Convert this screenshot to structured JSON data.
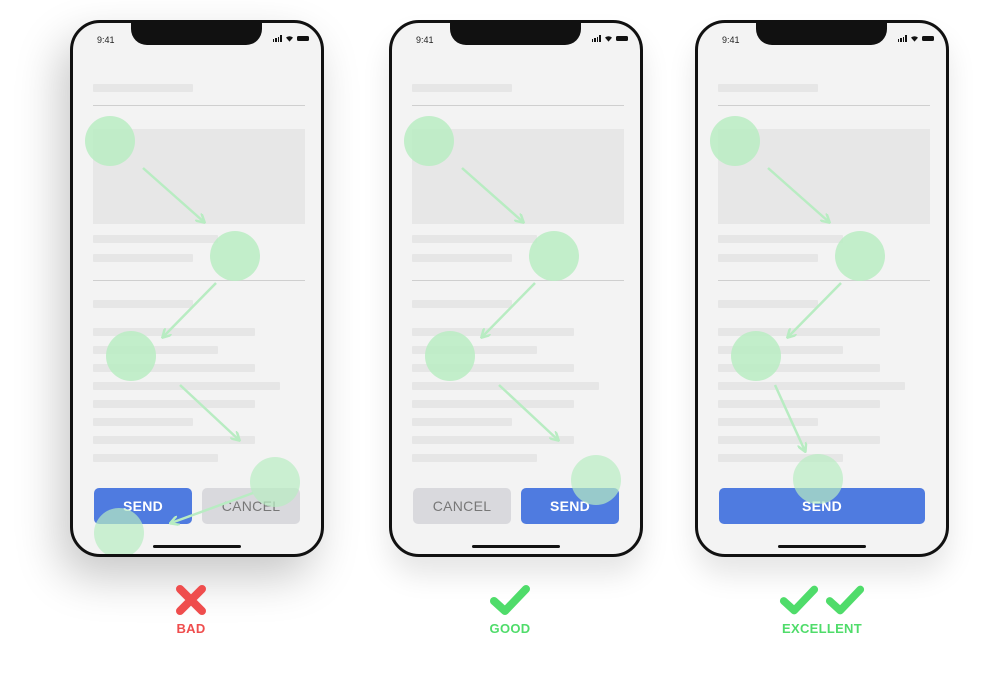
{
  "colors": {
    "primary": "#4f7be0",
    "secondary": "#d9d9dd",
    "touch": "#b8ecc2",
    "bad": "#ef4d4d",
    "good": "#4fdc6a"
  },
  "phones": [
    {
      "status_time": "9:41",
      "buttons": [
        {
          "label": "SEND",
          "style": "primary"
        },
        {
          "label": "CANCEL",
          "style": "secondary"
        }
      ],
      "verdict": {
        "icon": "cross-icon",
        "label": "BAD",
        "count": 1
      }
    },
    {
      "status_time": "9:41",
      "buttons": [
        {
          "label": "CANCEL",
          "style": "secondary"
        },
        {
          "label": "SEND",
          "style": "primary"
        }
      ],
      "verdict": {
        "icon": "check-icon",
        "label": "GOOD",
        "count": 1
      }
    },
    {
      "status_time": "9:41",
      "buttons": [
        {
          "label": "SEND",
          "style": "primary"
        }
      ],
      "verdict": {
        "icon": "check-icon",
        "label": "EXCELLENT",
        "count": 2
      }
    }
  ]
}
